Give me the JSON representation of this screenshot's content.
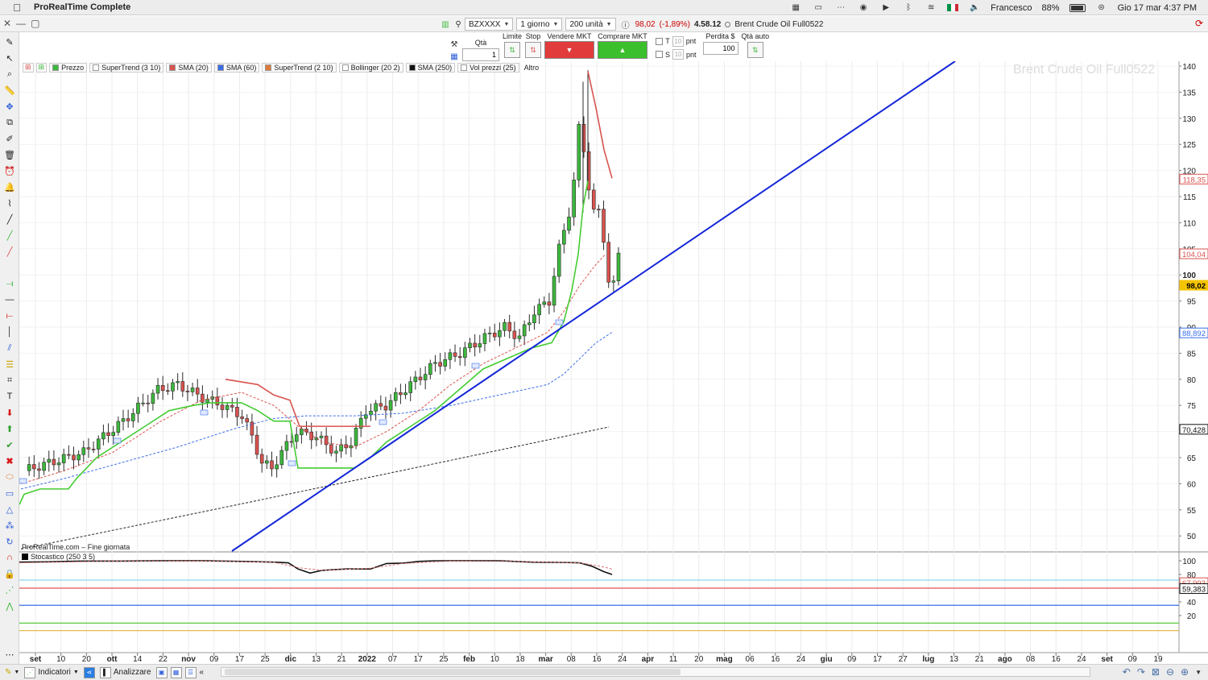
{
  "menubar": {
    "app_name": "ProRealTime Complete",
    "user": "Francesco",
    "battery": "88%",
    "battery_level": 0.88,
    "datetime": "Gio 17 mar  4:37 PM"
  },
  "toolbar": {
    "ticker": "BZXXXX",
    "timeframe": "1 giorno",
    "units": "200 unità",
    "last_price": "98,02",
    "change": "(-1,89%)",
    "time": "4.58.12",
    "instrument": "Brent Crude Oil Full0522"
  },
  "trade_panel": {
    "qty_label": "Qtà",
    "qty_value": "1",
    "limit_label": "Limite",
    "stop_label": "Stop",
    "sell_label": "Vendere MKT",
    "buy_label": "Comprare MKT",
    "t_label": "T",
    "s_label": "S",
    "pnt_value": "10",
    "pnt_label": "pnt",
    "loss_label": "Perdita $",
    "loss_value": "100",
    "auto_qty_label": "Qtà auto"
  },
  "legend": [
    {
      "label": "Prezzo",
      "color": "#3cb83c"
    },
    {
      "label": "SuperTrend (3 10)",
      "color": "#ffffff"
    },
    {
      "label": "SMA (20)",
      "color": "#d9534f"
    },
    {
      "label": "SMA (60)",
      "color": "#3a6ee8"
    },
    {
      "label": "SuperTrend (2 10)",
      "color": "#e07a3a"
    },
    {
      "label": "Bollinger (20 2)",
      "color": "#ffffff"
    },
    {
      "label": "SMA (250)",
      "color": "#111111"
    },
    {
      "label": "Vol prezzi (25)",
      "color": "#ffffff"
    },
    {
      "label": "Altro",
      "color": ""
    }
  ],
  "watermark": "Brent Crude Oil Full0522",
  "footer_note": "ProRealTime.com – Fine giornata",
  "stoch_label": "Stocastico (250 3 5)",
  "price_axis": {
    "ticks": [
      "140",
      "135",
      "130",
      "125",
      "120",
      "115",
      "110",
      "105",
      "100",
      "95",
      "90",
      "85",
      "80",
      "75",
      "70",
      "65",
      "60",
      "55",
      "50"
    ],
    "tags": [
      {
        "value": "118,35",
        "color": "#d9534f"
      },
      {
        "value": "104,04",
        "color": "#d9534f"
      },
      {
        "value": "98,02",
        "color": "#f5c400"
      },
      {
        "value": "88,892",
        "color": "#3a6ee8"
      },
      {
        "value": "70,428",
        "color": "#111111"
      }
    ]
  },
  "stoch_axis": {
    "ticks": [
      "100",
      "80",
      "60",
      "40",
      "20"
    ],
    "tags": [
      {
        "value": "67,993",
        "color": "#d9534f"
      },
      {
        "value": "59,383",
        "color": "#111111"
      }
    ]
  },
  "time_axis": [
    {
      "label": "set",
      "bold": true
    },
    {
      "label": "10"
    },
    {
      "label": "20"
    },
    {
      "label": "ott",
      "bold": true
    },
    {
      "label": "14"
    },
    {
      "label": "22"
    },
    {
      "label": "nov",
      "bold": true
    },
    {
      "label": "09"
    },
    {
      "label": "17"
    },
    {
      "label": "25"
    },
    {
      "label": "dic",
      "bold": true
    },
    {
      "label": "13"
    },
    {
      "label": "21"
    },
    {
      "label": "2022",
      "bold": true
    },
    {
      "label": "07"
    },
    {
      "label": "17"
    },
    {
      "label": "25"
    },
    {
      "label": "feb",
      "bold": true
    },
    {
      "label": "10"
    },
    {
      "label": "18"
    },
    {
      "label": "mar",
      "bold": true
    },
    {
      "label": "08"
    },
    {
      "label": "16"
    },
    {
      "label": "24"
    },
    {
      "label": "apr",
      "bold": true
    },
    {
      "label": "11"
    },
    {
      "label": "20"
    },
    {
      "label": "mag",
      "bold": true
    },
    {
      "label": "06"
    },
    {
      "label": "16"
    },
    {
      "label": "24"
    },
    {
      "label": "giu",
      "bold": true
    },
    {
      "label": "09"
    },
    {
      "label": "17"
    },
    {
      "label": "27"
    },
    {
      "label": "lug",
      "bold": true
    },
    {
      "label": "13"
    },
    {
      "label": "21"
    },
    {
      "label": "ago",
      "bold": true
    },
    {
      "label": "08"
    },
    {
      "label": "16"
    },
    {
      "label": "24"
    },
    {
      "label": "set",
      "bold": true
    },
    {
      "label": "09"
    },
    {
      "label": "19"
    }
  ],
  "bottom": {
    "indicators_label": "Indicatori",
    "analyze_label": "Analizzare"
  },
  "colors": {
    "up": "#3cb83c",
    "down": "#d9534f",
    "trendline": "#1426d8"
  }
}
